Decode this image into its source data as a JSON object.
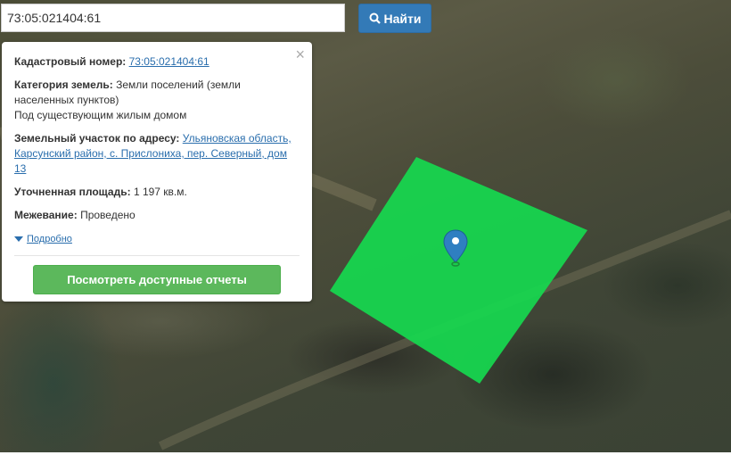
{
  "search": {
    "value": "73:05:021404:61",
    "button_label": "Найти",
    "button_icon": "search-icon"
  },
  "popup": {
    "close_label": "×",
    "cadastral_label": "Кадастровый номер:",
    "cadastral_value": "73:05:021404:61",
    "category_label": "Категория земель:",
    "category_value": "Земли поселений (земли населенных пунктов)",
    "usage_value": "Под существующим жилым домом",
    "address_label": "Земельный участок по адресу:",
    "address_value": "Ульяновская область, Карсунский район, с. Прислониха, пер. Северный, дом 13",
    "area_label": "Уточненная площадь:",
    "area_value": "1 197 кв.м.",
    "survey_label": "Межевание:",
    "survey_value": "Проведено",
    "details_label": "Подробно",
    "report_button_label": "Посмотреть доступные отчеты"
  },
  "map": {
    "parcel_color": "#16d94f",
    "marker_color": "#2f7fc1",
    "marker_icon": "map-pin-icon"
  }
}
